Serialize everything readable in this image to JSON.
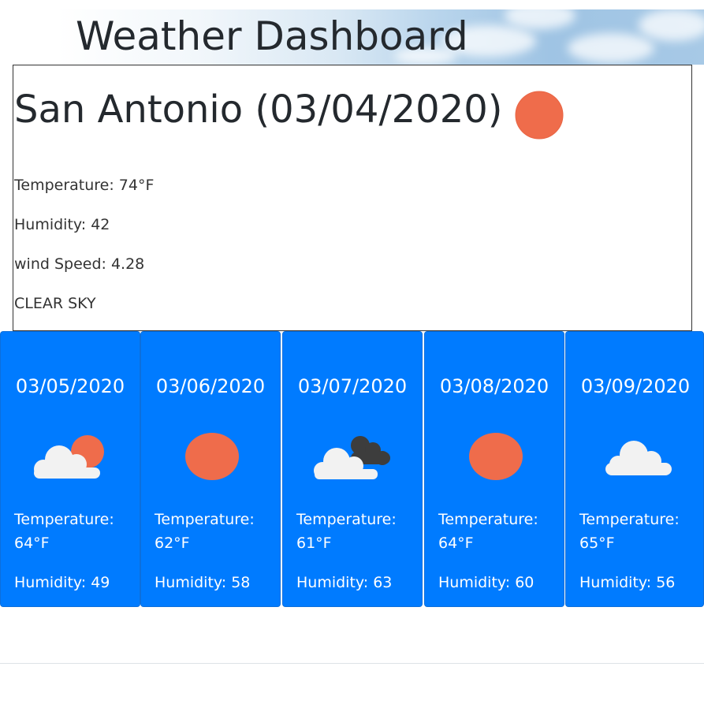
{
  "header": {
    "title": "Weather Dashboard"
  },
  "current": {
    "city_title": "San Antonio (03/04/2020)",
    "icon": "sun-icon",
    "temperature": "Temperature: 74°F",
    "humidity": "Humidity: 42",
    "wind": "wind Speed: 4.28",
    "description": "CLEAR SKY"
  },
  "forecast": [
    {
      "date": "03/05/2020",
      "icon": "partly-cloudy-icon",
      "temp_label": "Temperature:",
      "temp_value": "64°F",
      "humidity": "Humidity: 49"
    },
    {
      "date": "03/06/2020",
      "icon": "sun-icon",
      "temp_label": "Temperature:",
      "temp_value": "62°F",
      "humidity": "Humidity: 58"
    },
    {
      "date": "03/07/2020",
      "icon": "broken-clouds-icon",
      "temp_label": "Temperature:",
      "temp_value": "61°F",
      "humidity": "Humidity: 63"
    },
    {
      "date": "03/08/2020",
      "icon": "sun-icon",
      "temp_label": "Temperature:",
      "temp_value": "64°F",
      "humidity": "Humidity: 60"
    },
    {
      "date": "03/09/2020",
      "icon": "cloud-icon",
      "temp_label": "Temperature:",
      "temp_value": "65°F",
      "humidity": "Humidity: 56"
    }
  ],
  "colors": {
    "card_blue": "#007bff",
    "sun_orange": "#ef6c4b",
    "cloud_white": "#f2f2f2",
    "cloud_dark": "#3d3d3d"
  }
}
